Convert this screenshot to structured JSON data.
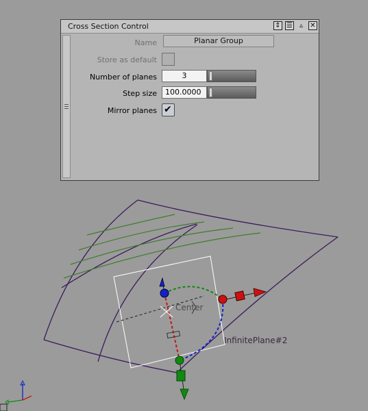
{
  "panel": {
    "title": "Cross Section Control",
    "fields": {
      "name_label": "Name",
      "name_value": "Planar Group",
      "store_default_label": "Store as default",
      "store_default_checked": false,
      "planes_label": "Number of planes",
      "planes_value": "3",
      "step_label": "Step size",
      "step_value": "100.0000",
      "mirror_label": "Mirror planes",
      "mirror_checked": true
    }
  },
  "viewport": {
    "center_label": "Center",
    "plane_label": "InfinitePlane#2"
  },
  "colors": {
    "surface_edge": "#3b1a5a",
    "section_lines": "#3f7d2a",
    "x_axis": "#cc1111",
    "y_axis": "#118811",
    "z_axis": "#1122cc"
  }
}
